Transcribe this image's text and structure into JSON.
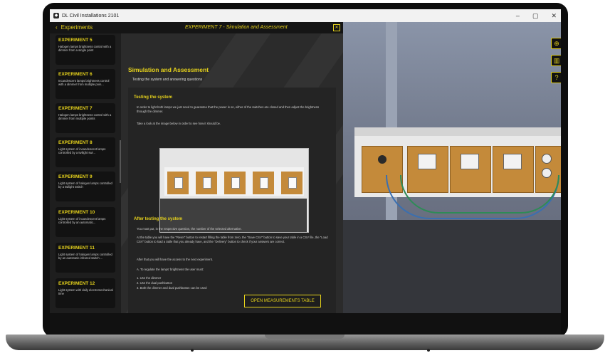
{
  "window": {
    "title": "DL Civil Installations 2101",
    "controls": [
      "–",
      "▢",
      "✕"
    ]
  },
  "topbar": {
    "back_label": "Experiments",
    "title": "EXPERIMENT 7 - Simulation and Assessment",
    "close": "✕"
  },
  "sidebar": {
    "items": [
      {
        "title": "EXPERIMENT 5",
        "desc": "Halogen lamps brightness control with a dimmer from a single point"
      },
      {
        "title": "EXPERIMENT 6",
        "desc": "Incandescent lamps brightness control with a dimmer from multiple poin..."
      },
      {
        "title": "EXPERIMENT 7",
        "desc": "Halogen lamps brightness control with a dimmer from multiple points"
      },
      {
        "title": "EXPERIMENT 8",
        "desc": "Light system of incandescent lamps controlled by a twilight swi..."
      },
      {
        "title": "EXPERIMENT 9",
        "desc": "Light system of halogen lamps controlled by a twilight switch"
      },
      {
        "title": "EXPERIMENT 10",
        "desc": "Light system of incandescent lamps controlled by an automatic..."
      },
      {
        "title": "EXPERIMENT 11",
        "desc": "Light system of halogen lamps controlled by an automatic infrared switch ..."
      },
      {
        "title": "EXPERIMENT 12",
        "desc": "Light system with daily electromechanical time"
      }
    ]
  },
  "content": {
    "heading": "Simulation and Assessment",
    "subheading": "Testing the system and answering questions",
    "testing_title": "Testing the system",
    "testing_p1": "In order to light both lamps we just need to guarantee that the power is on, either of the switches are closed and then adjust the brightness through the dimmer.",
    "testing_p2": "Take a look at the image below in order to see how it should be.",
    "after_title": "After testing the system",
    "after_p1": "You must put, in the respective question, the number of the selected alternative.",
    "after_p2": "At the table you will have the \"Reset\" button to restart filling the table from zero, the \"Save CSV\" button to save your table in a CSV file, the \"Load CSV\" button to load a table that you already have, and the \"Delivery\" button to check if your answers are correct.",
    "after_p3": "After that you will have the access to the next experiment.",
    "question": "A. To regulate the lamps' brightness the user must:",
    "options": [
      "1. Use the dimmer",
      "2. Use the dual pushbutton",
      "3. Both the dimmer and dual pushbutton can be used"
    ],
    "open_table_button": "OPEN MEASUREMENTS TABLE"
  },
  "toolbar_right": {
    "icons": [
      "globe-icon",
      "chart-icon",
      "help-icon"
    ]
  },
  "colors": {
    "accent": "#e6d21c",
    "panel": "#242424",
    "module": "#c48a3a"
  }
}
